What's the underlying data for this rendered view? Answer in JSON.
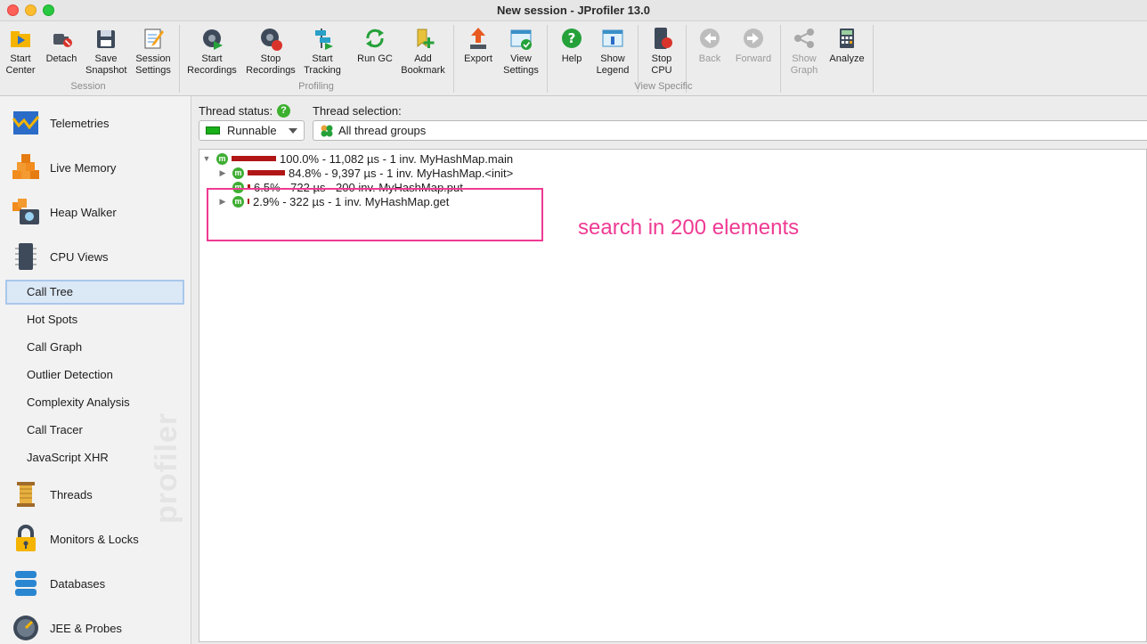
{
  "window": {
    "title": "New session - JProfiler 13.0"
  },
  "toolbar": {
    "buttons": [
      {
        "label": "Start Center",
        "icon": "start-center-icon"
      },
      {
        "label": "Detach",
        "icon": "detach-icon"
      },
      {
        "label": "Save Snapshot",
        "icon": "save-snapshot-icon"
      },
      {
        "label": "Session Settings",
        "icon": "session-settings-icon"
      },
      {
        "label": "Start Recordings",
        "icon": "start-recordings-icon"
      },
      {
        "label": "Stop Recordings",
        "icon": "stop-recordings-icon"
      },
      {
        "label": "Start Tracking",
        "icon": "start-tracking-icon"
      },
      {
        "label": "Run GC",
        "icon": "run-gc-icon"
      },
      {
        "label": "Add Bookmark",
        "icon": "add-bookmark-icon"
      },
      {
        "label": "Export",
        "icon": "export-icon"
      },
      {
        "label": "View Settings",
        "icon": "view-settings-icon"
      },
      {
        "label": "Help",
        "icon": "help-icon"
      },
      {
        "label": "Show Legend",
        "icon": "show-legend-icon"
      },
      {
        "label": "Stop CPU",
        "icon": "stop-cpu-icon"
      },
      {
        "label": "Back",
        "icon": "back-icon",
        "disabled": true
      },
      {
        "label": "Forward",
        "icon": "forward-icon",
        "disabled": true
      },
      {
        "label": "Show Graph",
        "icon": "show-graph-icon",
        "disabled": true
      },
      {
        "label": "Analyze",
        "icon": "analyze-icon"
      }
    ],
    "groups": [
      "Session",
      "Profiling",
      "View Specific"
    ]
  },
  "sidebar": {
    "categories": [
      {
        "label": "Telemetries",
        "icon": "telemetries-icon"
      },
      {
        "label": "Live Memory",
        "icon": "live-memory-icon"
      },
      {
        "label": "Heap Walker",
        "icon": "heap-walker-icon"
      },
      {
        "label": "CPU Views",
        "icon": "cpu-views-icon"
      },
      {
        "label": "Threads",
        "icon": "threads-icon"
      },
      {
        "label": "Monitors & Locks",
        "icon": "monitors-locks-icon"
      },
      {
        "label": "Databases",
        "icon": "databases-icon"
      },
      {
        "label": "JEE & Probes",
        "icon": "jee-probes-icon"
      }
    ],
    "cpu_subitems": [
      "Call Tree",
      "Hot Spots",
      "Call Graph",
      "Outlier Detection",
      "Complexity Analysis",
      "Call Tracer",
      "JavaScript XHR"
    ],
    "selected": "Call Tree",
    "watermark": "profiler"
  },
  "filters": {
    "thread_status_label": "Thread status:",
    "thread_status_value": "Runnable",
    "thread_selection_label": "Thread selection:",
    "thread_selection_value": "All thread groups",
    "help_glyph": "?"
  },
  "call_tree": {
    "method_glyph": "m",
    "nodes": [
      {
        "text": "100.0% - 11,082 µs - 1 inv. MyHashMap.main",
        "percent": 100.0,
        "expanded": true
      },
      {
        "text": "84.8% - 9,397 µs - 1 inv. MyHashMap.<init>",
        "percent": 84.8,
        "expanded": false
      },
      {
        "text": "6.5% - 722 µs - 200 inv. MyHashMap.put",
        "percent": 6.5,
        "expanded": null
      },
      {
        "text": "2.9% - 322 µs - 1 inv. MyHashMap.get",
        "percent": 2.9,
        "expanded": false
      }
    ]
  },
  "annotation": {
    "text": "search in 200 elements",
    "color": "#ef3a93"
  }
}
